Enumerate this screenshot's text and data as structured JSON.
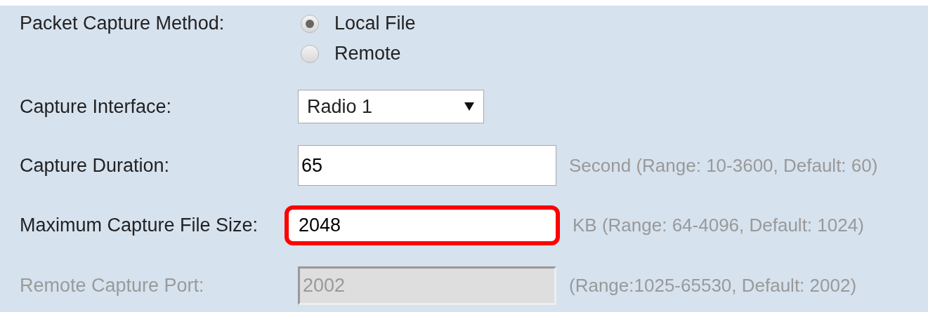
{
  "method": {
    "label": "Packet Capture Method:",
    "options": [
      {
        "label": "Local File",
        "selected": true
      },
      {
        "label": "Remote",
        "selected": false
      }
    ]
  },
  "fields": [
    {
      "kind": "select",
      "label": "Capture Interface:",
      "value": "Radio 1"
    },
    {
      "kind": "text",
      "label": "Capture Duration:",
      "value": "65",
      "hint": "Second (Range: 10-3600, Default: 60)"
    },
    {
      "kind": "text",
      "label": "Maximum Capture File Size:",
      "value": "2048",
      "hint": "KB (Range: 64-4096, Default: 1024)",
      "highlighted": true
    },
    {
      "kind": "text",
      "label": "Remote Capture Port:",
      "value": "2002",
      "hint": "(Range:1025-65530, Default: 2002)",
      "disabled": true
    }
  ]
}
